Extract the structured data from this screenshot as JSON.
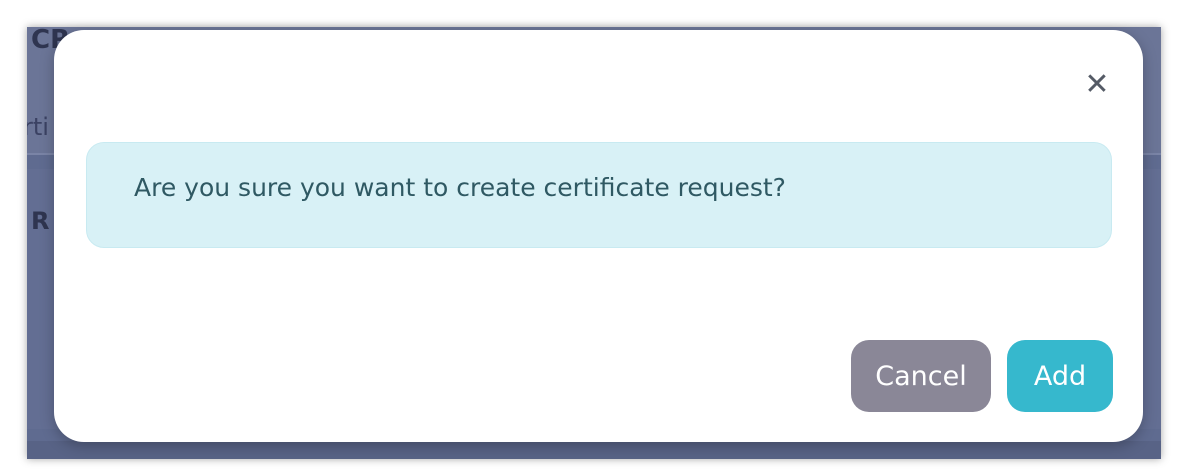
{
  "background": {
    "heading_fragment": "CR",
    "tab_fragment": "rti",
    "row_label_fragment": "R"
  },
  "modal": {
    "close_glyph": "✕",
    "message": "Are you sure you want to create certificate request?",
    "buttons": {
      "cancel_label": "Cancel",
      "add_label": "Add"
    }
  },
  "colors": {
    "overlay": "#5f6b90",
    "alert_bg": "#d8f1f6",
    "alert_text": "#2f5963",
    "cancel_bg": "#8a8797",
    "add_bg": "#36b8cd"
  }
}
